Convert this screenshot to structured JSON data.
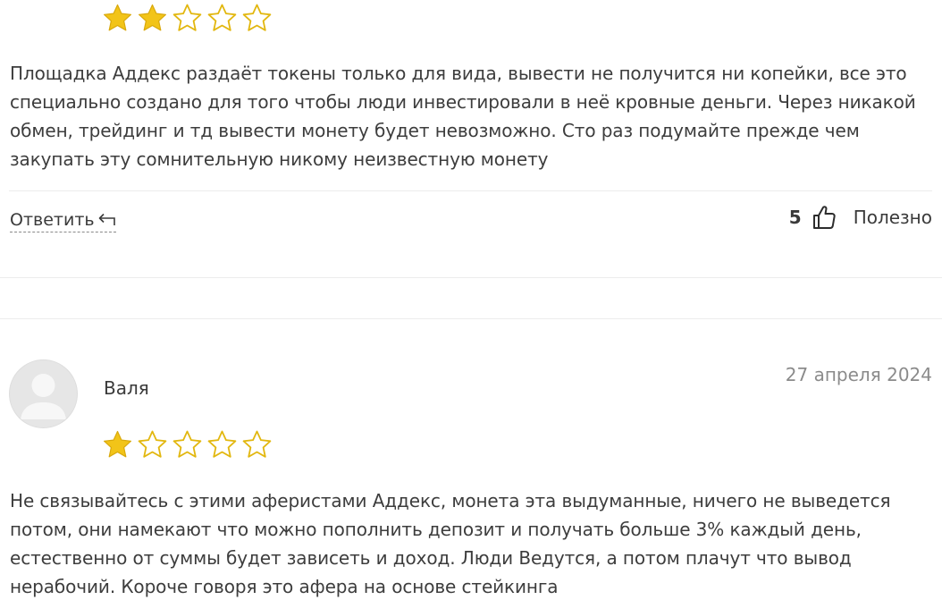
{
  "review_top": {
    "rating": 2,
    "max_rating": 5,
    "text": "Площадка Аддекс раздаёт токены только для вида, вывести не получится ни копейки, все это специально создано для того чтобы люди инвестировали в неё кровные деньги. Через никакой обмен, трейдинг и тд вывести монету будет невозможно. Сто раз подумайте прежде чем закупать эту сомнительную никому неизвестную монету",
    "reply_label": "Ответить",
    "reply_icon": "reply-arrow-icon",
    "helpful_count": "5",
    "helpful_icon": "thumbs-up-icon",
    "helpful_label": "Полезно"
  },
  "review_bottom": {
    "author": "Валя",
    "date": "27 апреля 2024",
    "avatar_icon": "user-avatar-placeholder-icon",
    "rating": 1,
    "max_rating": 5,
    "text": "Не связывайтесь с этими аферистами Аддекс, монета эта выдуманные, ничего не выведется потом, они намекают что можно пополнить депозит и получать больше 3% каждый день, естественно от суммы будет зависеть и доход. Люди Ведутся, а потом плачут что вывод нерабочий. Короче говоря это афера на основе стейкинга"
  },
  "colors": {
    "star_filled": "#f2c418",
    "star_filled_stroke": "#d9a90c",
    "star_empty_stroke": "#e2b70f",
    "text": "#3d3d3d",
    "date": "#8b8b8b",
    "divider": "#ececec",
    "avatar_bg": "#e6e6e6",
    "avatar_silhouette": "#f7f7f7"
  }
}
